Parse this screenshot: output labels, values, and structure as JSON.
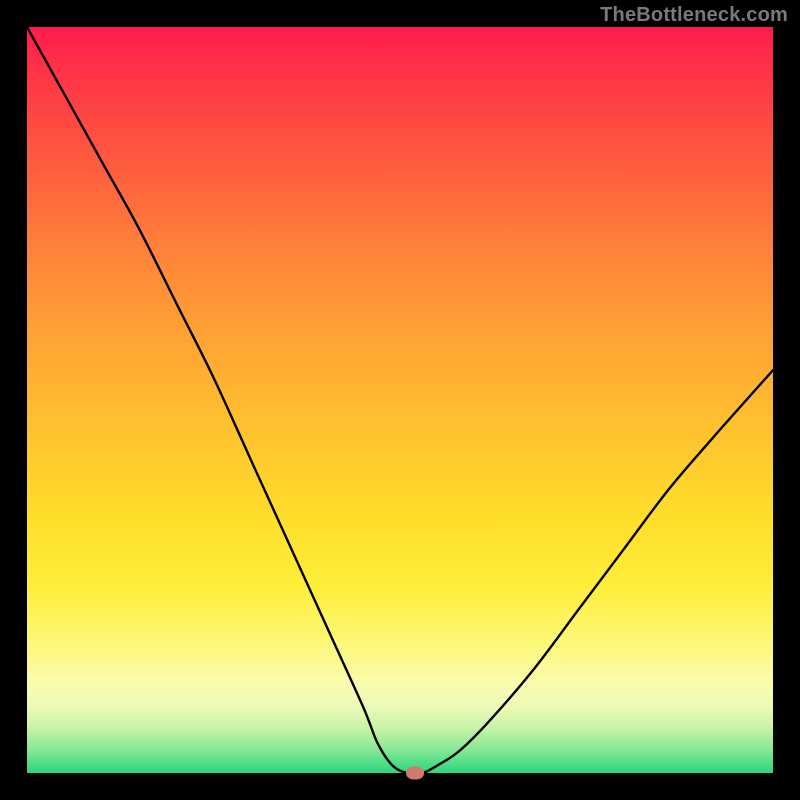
{
  "attribution": "TheBottleneck.com",
  "chart_data": {
    "type": "line",
    "title": "",
    "xlabel": "",
    "ylabel": "",
    "xlim": [
      0,
      100
    ],
    "ylim": [
      0,
      100
    ],
    "grid": false,
    "legend": false,
    "series": [
      {
        "name": "bottleneck-curve",
        "x": [
          0,
          5,
          10,
          15,
          20,
          25,
          30,
          35,
          40,
          45,
          47,
          49,
          51,
          53,
          55,
          58,
          62,
          68,
          74,
          80,
          86,
          92,
          100
        ],
        "values": [
          100,
          91,
          82,
          73,
          63,
          53,
          42,
          31,
          20,
          9,
          4,
          1,
          0,
          0,
          1,
          3,
          7,
          14,
          22,
          30,
          38,
          45,
          54
        ]
      }
    ],
    "marker": {
      "x": 52,
      "y": 0
    },
    "gradient_stops": [
      {
        "pos": 0,
        "color": "#ff1b4d"
      },
      {
        "pos": 18,
        "color": "#ff5a3f"
      },
      {
        "pos": 42,
        "color": "#ffa434"
      },
      {
        "pos": 66,
        "color": "#ffde2b"
      },
      {
        "pos": 88,
        "color": "#f9fcae"
      },
      {
        "pos": 97,
        "color": "#83e793"
      },
      {
        "pos": 100,
        "color": "#2bd67f"
      }
    ]
  }
}
